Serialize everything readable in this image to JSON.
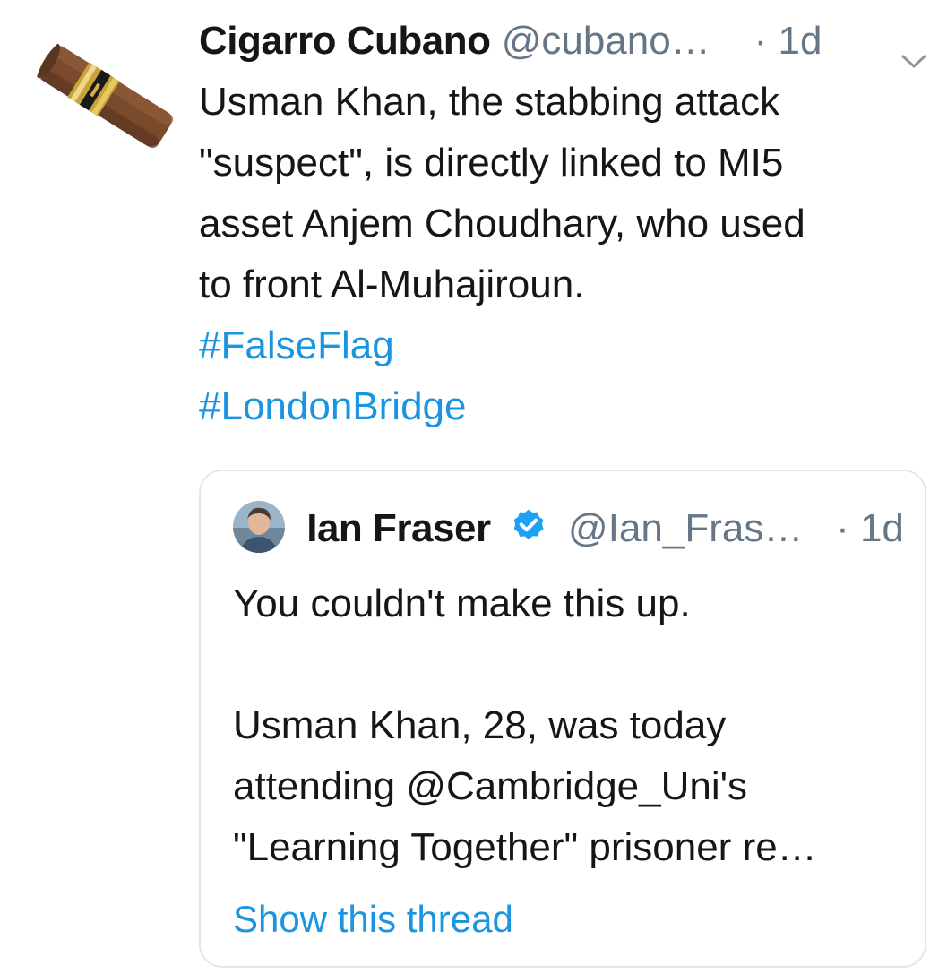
{
  "tweet": {
    "author_name": "Cigarro Cubano",
    "author_handle": "@cubano…",
    "separator": "·",
    "time": "1d",
    "text": "Usman Khan, the stabbing attack\n\"suspect\", is directly linked to MI5\nasset Anjem Choudhary, who used\nto front Al-Muhajiroun.",
    "hashtags": [
      "#FalseFlag",
      "#LondonBridge"
    ],
    "avatar_icon": "cigar-avatar",
    "menu_icon": "chevron-down-icon"
  },
  "quoted": {
    "author_name": "Ian Fraser",
    "verified_icon": "verified-badge-icon",
    "author_handle": "@Ian_Fras…",
    "separator": "·",
    "time": "1d",
    "text": "You couldn't make this up.\n\nUsman Khan, 28, was today\nattending @Cambridge_Uni's\n\"Learning Together\" prisoner re…",
    "show_thread": "Show this thread"
  },
  "colors": {
    "link": "#1b95e0",
    "secondary_text": "#657786",
    "primary_text": "#14171a",
    "border": "#e1e8ed"
  }
}
